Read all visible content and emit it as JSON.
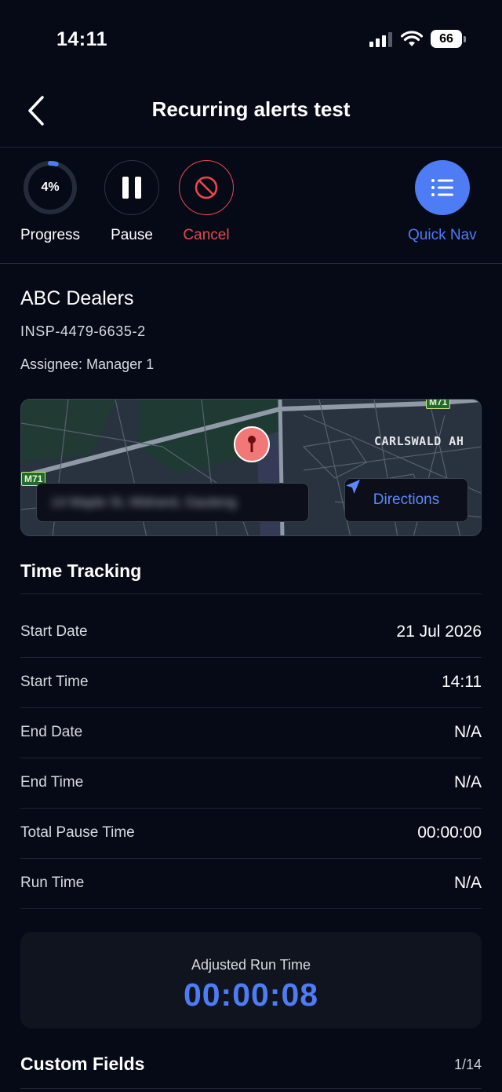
{
  "status_bar": {
    "time": "14:11",
    "battery": "66"
  },
  "header": {
    "title": "Recurring alerts test"
  },
  "actions": {
    "progress": {
      "value": "4%",
      "fraction": 0.04,
      "label": "Progress"
    },
    "pause": {
      "label": "Pause"
    },
    "cancel": {
      "label": "Cancel"
    },
    "quick_nav": {
      "label": "Quick Nav"
    }
  },
  "inspection": {
    "company": "ABC Dealers",
    "id": "INSP-4479-6635-2",
    "assignee": "Assignee: Manager 1"
  },
  "map": {
    "area_label": "CARLSWALD AH",
    "road_shield_left": "M71",
    "road_shield_top": "M71",
    "address": "14 Maple St, Midrand, Gauteng",
    "directions_label": "Directions"
  },
  "time_tracking": {
    "title": "Time Tracking",
    "rows": [
      {
        "label": "Start Date",
        "value": "21 Jul 2026"
      },
      {
        "label": "Start Time",
        "value": "14:11"
      },
      {
        "label": "End Date",
        "value": "N/A"
      },
      {
        "label": "End Time",
        "value": "N/A"
      },
      {
        "label": "Total Pause Time",
        "value": "00:00:00"
      },
      {
        "label": "Run Time",
        "value": "N/A"
      }
    ],
    "adjusted_label": "Adjusted Run Time",
    "adjusted_value": "00:00:08"
  },
  "custom_fields": {
    "title": "Custom Fields",
    "count": "1/14"
  },
  "colors": {
    "accent": "#4d7cf4",
    "danger": "#e5484d",
    "background": "#060a16"
  }
}
